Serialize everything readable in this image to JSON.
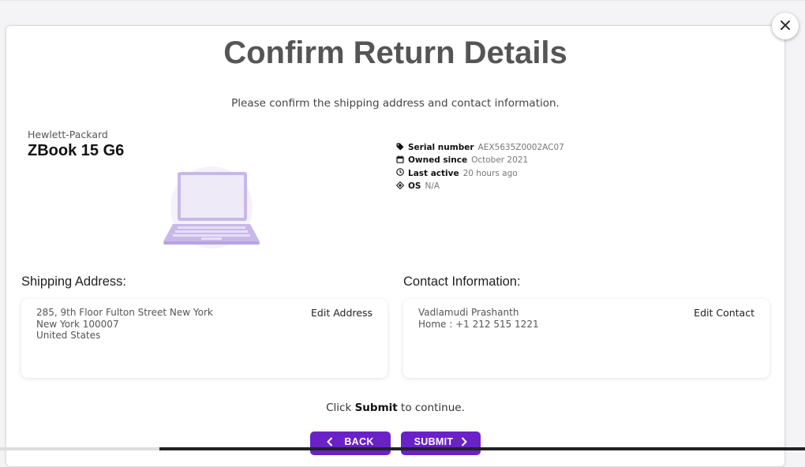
{
  "modal": {
    "title": "Confirm Return Details",
    "subtitle": "Please confirm the shipping address and contact information.",
    "close_icon": "close-icon"
  },
  "device": {
    "brand": "Hewlett-Packard",
    "model": "ZBook 15 G6",
    "image_icon": "laptop-icon",
    "specs": [
      {
        "icon": "tag-icon",
        "label": "Serial number",
        "value": "AEX5635Z0002AC07"
      },
      {
        "icon": "calendar-icon",
        "label": "Owned since",
        "value": "October 2021"
      },
      {
        "icon": "clock-icon",
        "label": "Last active",
        "value": "20 hours ago"
      },
      {
        "icon": "os-icon",
        "label": "OS",
        "value": "N/A"
      }
    ]
  },
  "shipping": {
    "title": "Shipping Address:",
    "lines": [
      "285, 9th Floor Fulton Street New York",
      "New York 100007",
      "United States"
    ],
    "edit_label": "Edit Address"
  },
  "contact": {
    "title": "Contact Information:",
    "lines": [
      "Vadlamudi Prashanth",
      "Home : +1 212 515 1221"
    ],
    "edit_label": "Edit Contact"
  },
  "footer": {
    "hint_prefix": "Click ",
    "hint_bold": "Submit",
    "hint_suffix": " to continue.",
    "back_label": "BACK",
    "submit_label": "SUBMIT"
  },
  "colors": {
    "accent": "#6b21c8",
    "laptop": "#c8b8e8"
  }
}
